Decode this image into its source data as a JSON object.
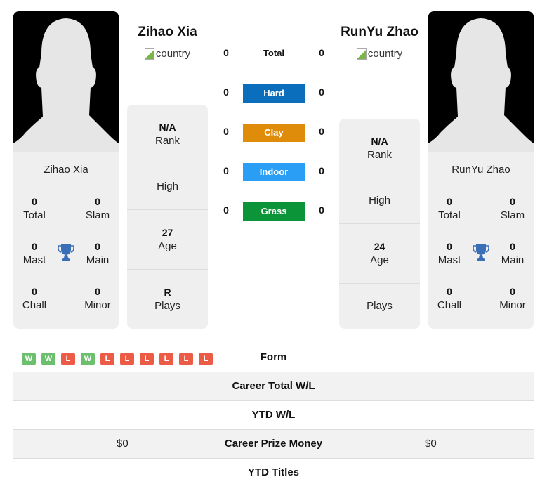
{
  "player_left": {
    "name": "Zihao Xia",
    "country_alt": "country",
    "card_name": "Zihao Xia",
    "titles": {
      "total": {
        "value": "0",
        "label": "Total"
      },
      "slam": {
        "value": "0",
        "label": "Slam"
      },
      "mast": {
        "value": "0",
        "label": "Mast"
      },
      "main": {
        "value": "0",
        "label": "Main"
      },
      "chall": {
        "value": "0",
        "label": "Chall"
      },
      "minor": {
        "value": "0",
        "label": "Minor"
      }
    },
    "profile": {
      "rank": {
        "value": "N/A",
        "label": "Rank"
      },
      "high": {
        "value": "",
        "label": "High"
      },
      "age": {
        "value": "27",
        "label": "Age"
      },
      "plays": {
        "value": "R",
        "label": "Plays"
      }
    }
  },
  "player_right": {
    "name": "RunYu Zhao",
    "country_alt": "country",
    "card_name": "RunYu Zhao",
    "titles": {
      "total": {
        "value": "0",
        "label": "Total"
      },
      "slam": {
        "value": "0",
        "label": "Slam"
      },
      "mast": {
        "value": "0",
        "label": "Mast"
      },
      "main": {
        "value": "0",
        "label": "Main"
      },
      "chall": {
        "value": "0",
        "label": "Chall"
      },
      "minor": {
        "value": "0",
        "label": "Minor"
      }
    },
    "profile": {
      "rank": {
        "value": "N/A",
        "label": "Rank"
      },
      "high": {
        "value": "",
        "label": "High"
      },
      "age": {
        "value": "24",
        "label": "Age"
      },
      "plays": {
        "value": "",
        "label": "Plays"
      }
    }
  },
  "h2h": [
    {
      "label": "Total",
      "left": "0",
      "right": "0",
      "color": null
    },
    {
      "label": "Hard",
      "left": "0",
      "right": "0",
      "color": "#0a6ebd"
    },
    {
      "label": "Clay",
      "left": "0",
      "right": "0",
      "color": "#e08c0b"
    },
    {
      "label": "Indoor",
      "left": "0",
      "right": "0",
      "color": "#2a9df4"
    },
    {
      "label": "Grass",
      "left": "0",
      "right": "0",
      "color": "#0c9438"
    }
  ],
  "form": {
    "label": "Form",
    "results": [
      "W",
      "W",
      "L",
      "W",
      "L",
      "L",
      "L",
      "L",
      "L",
      "L"
    ]
  },
  "comparison": [
    {
      "label": "Career Total W/L",
      "left": "",
      "right": ""
    },
    {
      "label": "YTD W/L",
      "left": "",
      "right": ""
    },
    {
      "label": "Career Prize Money",
      "left": "$0",
      "right": "$0"
    },
    {
      "label": "YTD Titles",
      "left": "",
      "right": ""
    }
  ],
  "colors": {
    "trophy": "#3a6fb8",
    "win": "#6cbf6c",
    "loss": "#ec5b45"
  }
}
